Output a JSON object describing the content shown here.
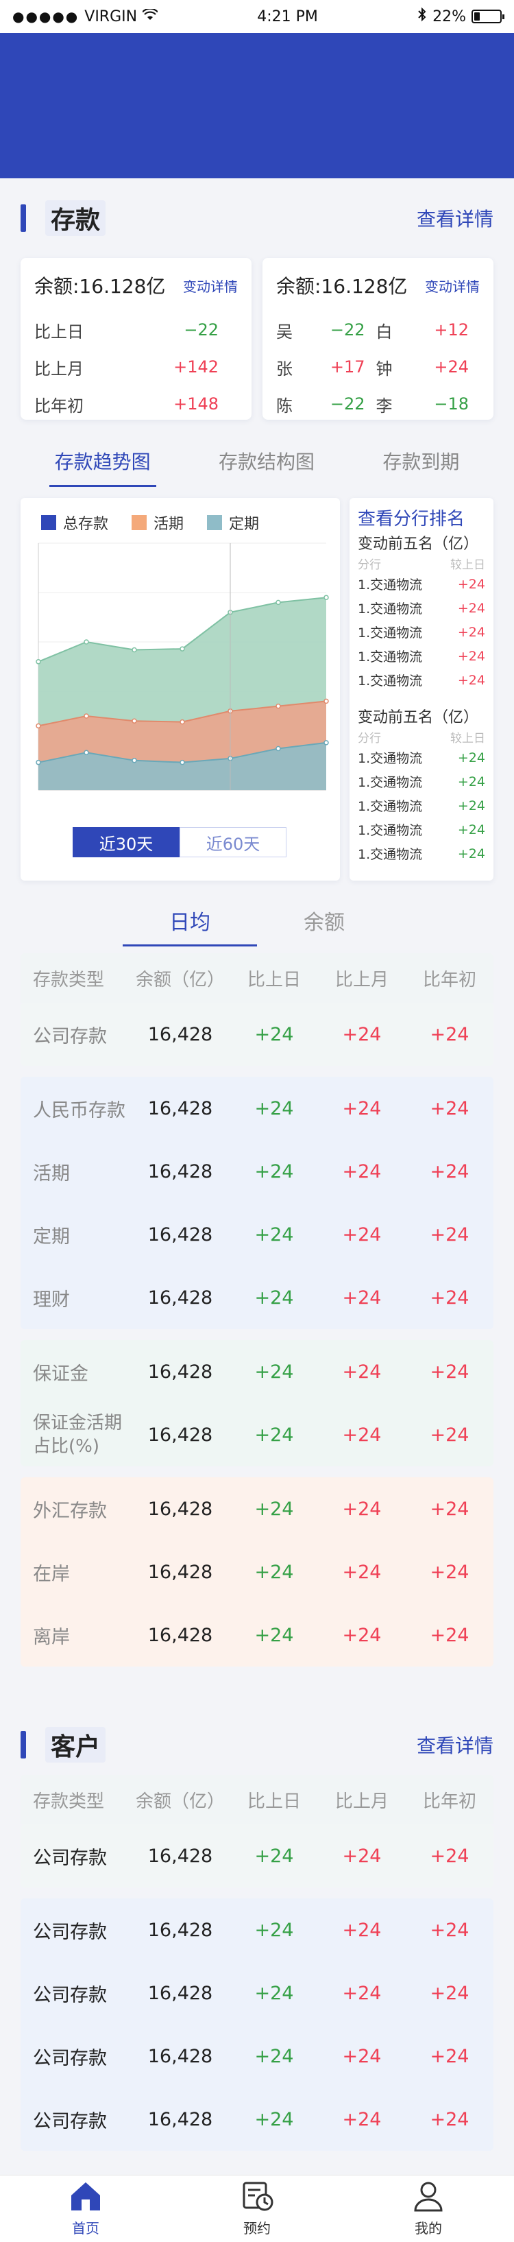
{
  "status_bar": {
    "carrier": "VIRGIN",
    "time": "4:21 PM",
    "battery": "22%",
    "battery_level": 0.22
  },
  "deposit": {
    "title": "存款",
    "more": "查看详情",
    "card1": {
      "amount": "余额:16.128亿",
      "link": "变动详情",
      "rows": [
        {
          "label": "比上日",
          "value": "−22",
          "tone": "green"
        },
        {
          "label": "比上月",
          "value": "+142",
          "tone": "red"
        },
        {
          "label": "比年初",
          "value": "+148",
          "tone": "red"
        }
      ]
    },
    "card2": {
      "amount": "余额:16.128亿",
      "link": "变动详情",
      "rows": [
        {
          "n1": "吴",
          "v1": "−22",
          "t1": "green",
          "n2": "白",
          "v2": "+12",
          "t2": "red"
        },
        {
          "n1": "张",
          "v1": "+17",
          "t1": "red",
          "n2": "钟",
          "v2": "+24",
          "t2": "red"
        },
        {
          "n1": "陈",
          "v1": "−22",
          "t1": "green",
          "n2": "李",
          "v2": "−18",
          "t2": "green"
        }
      ]
    },
    "tabs": [
      "存款趋势图",
      "存款结构图",
      "存款到期"
    ],
    "legend": [
      {
        "name": "总存款",
        "color": "#2f47b8"
      },
      {
        "name": "活期",
        "color": "#f4a97a"
      },
      {
        "name": "定期",
        "color": "#8fbcc8"
      }
    ],
    "range_buttons": {
      "on": "近30天",
      "off": "近60天"
    },
    "ranking": {
      "title": "查看分行排名",
      "group1": {
        "subtitle": "变动前五名（亿）",
        "col_a": "分行",
        "col_b": "较上日",
        "rows": [
          {
            "name": "1.交通物流",
            "value": "+24"
          },
          {
            "name": "1.交通物流",
            "value": "+24"
          },
          {
            "name": "1.交通物流",
            "value": "+24"
          },
          {
            "name": "1.交通物流",
            "value": "+24"
          },
          {
            "name": "1.交通物流",
            "value": "+24"
          }
        ]
      },
      "group2": {
        "subtitle": "变动前五名（亿）",
        "col_a": "分行",
        "col_b": "较上日",
        "rows": [
          {
            "name": "1.交通物流",
            "value": "+24"
          },
          {
            "name": "1.交通物流",
            "value": "+24"
          },
          {
            "name": "1.交通物流",
            "value": "+24"
          },
          {
            "name": "1.交通物流",
            "value": "+24"
          },
          {
            "name": "1.交通物流",
            "value": "+24"
          }
        ]
      }
    },
    "table_tabs": [
      "日均",
      "余额"
    ],
    "table_header": [
      "存款类型",
      "余额（亿）",
      "比上日",
      "比上月",
      "比年初"
    ],
    "groups": [
      {
        "tone": "gray",
        "rows": [
          {
            "type": "公司存款",
            "bal": "16,428",
            "d": "+24",
            "m": "+24",
            "y": "+24"
          }
        ]
      },
      {
        "tone": "blue",
        "rows": [
          {
            "type": "人民币存款",
            "bal": "16,428",
            "d": "+24",
            "m": "+24",
            "y": "+24"
          },
          {
            "type": "活期",
            "bal": "16,428",
            "d": "+24",
            "m": "+24",
            "y": "+24"
          },
          {
            "type": "定期",
            "bal": "16,428",
            "d": "+24",
            "m": "+24",
            "y": "+24"
          },
          {
            "type": "理财",
            "bal": "16,428",
            "d": "+24",
            "m": "+24",
            "y": "+24"
          }
        ]
      },
      {
        "tone": "mint",
        "rows": [
          {
            "type": "保证金",
            "bal": "16,428",
            "d": "+24",
            "m": "+24",
            "y": "+24"
          },
          {
            "type": "保证金活期占比(%)",
            "bal": "16,428",
            "d": "+24",
            "m": "+24",
            "y": "+24",
            "two_line": true
          }
        ]
      },
      {
        "tone": "peach",
        "rows": [
          {
            "type": "外汇存款",
            "bal": "16,428",
            "d": "+24",
            "m": "+24",
            "y": "+24"
          },
          {
            "type": "在岸",
            "bal": "16,428",
            "d": "+24",
            "m": "+24",
            "y": "+24"
          },
          {
            "type": "离岸",
            "bal": "16,428",
            "d": "+24",
            "m": "+24",
            "y": "+24"
          }
        ]
      }
    ]
  },
  "customer": {
    "title": "客户",
    "more": "查看详情",
    "table_header": [
      "存款类型",
      "余额（亿）",
      "比上日",
      "比上月",
      "比年初"
    ],
    "groups": [
      {
        "tone": "gray",
        "rows": [
          {
            "type": "公司存款",
            "bal": "16,428",
            "d": "+24",
            "m": "+24",
            "y": "+24"
          }
        ]
      },
      {
        "tone": "blue",
        "rows": [
          {
            "type": "公司存款",
            "bal": "16,428",
            "d": "+24",
            "m": "+24",
            "y": "+24"
          },
          {
            "type": "公司存款",
            "bal": "16,428",
            "d": "+24",
            "m": "+24",
            "y": "+24"
          },
          {
            "type": "公司存款",
            "bal": "16,428",
            "d": "+24",
            "m": "+24",
            "y": "+24"
          },
          {
            "type": "公司存款",
            "bal": "16,428",
            "d": "+24",
            "m": "+24",
            "y": "+24"
          }
        ]
      }
    ]
  },
  "nav": [
    {
      "label": "首页",
      "icon": "home-icon",
      "active": true
    },
    {
      "label": "预约",
      "icon": "calendar-clock-icon",
      "active": false
    },
    {
      "label": "我的",
      "icon": "user-icon",
      "active": false
    }
  ],
  "chart_data": {
    "type": "area",
    "x": [
      1,
      2,
      3,
      4,
      5,
      6,
      7
    ],
    "ylim": [
      0,
      2500
    ],
    "series": [
      {
        "name": "定期",
        "values": [
          1300,
          1500,
          1420,
          1430,
          1800,
          1900,
          1950
        ]
      },
      {
        "name": "活期",
        "values": [
          650,
          750,
          700,
          690,
          800,
          850,
          900
        ]
      },
      {
        "name": "总存款",
        "values": [
          280,
          380,
          300,
          280,
          320,
          420,
          480
        ]
      }
    ],
    "grid": true,
    "legend": "top"
  },
  "colors": {
    "primary": "#2f47b8",
    "up": "#ef4055",
    "down": "#35a046"
  }
}
